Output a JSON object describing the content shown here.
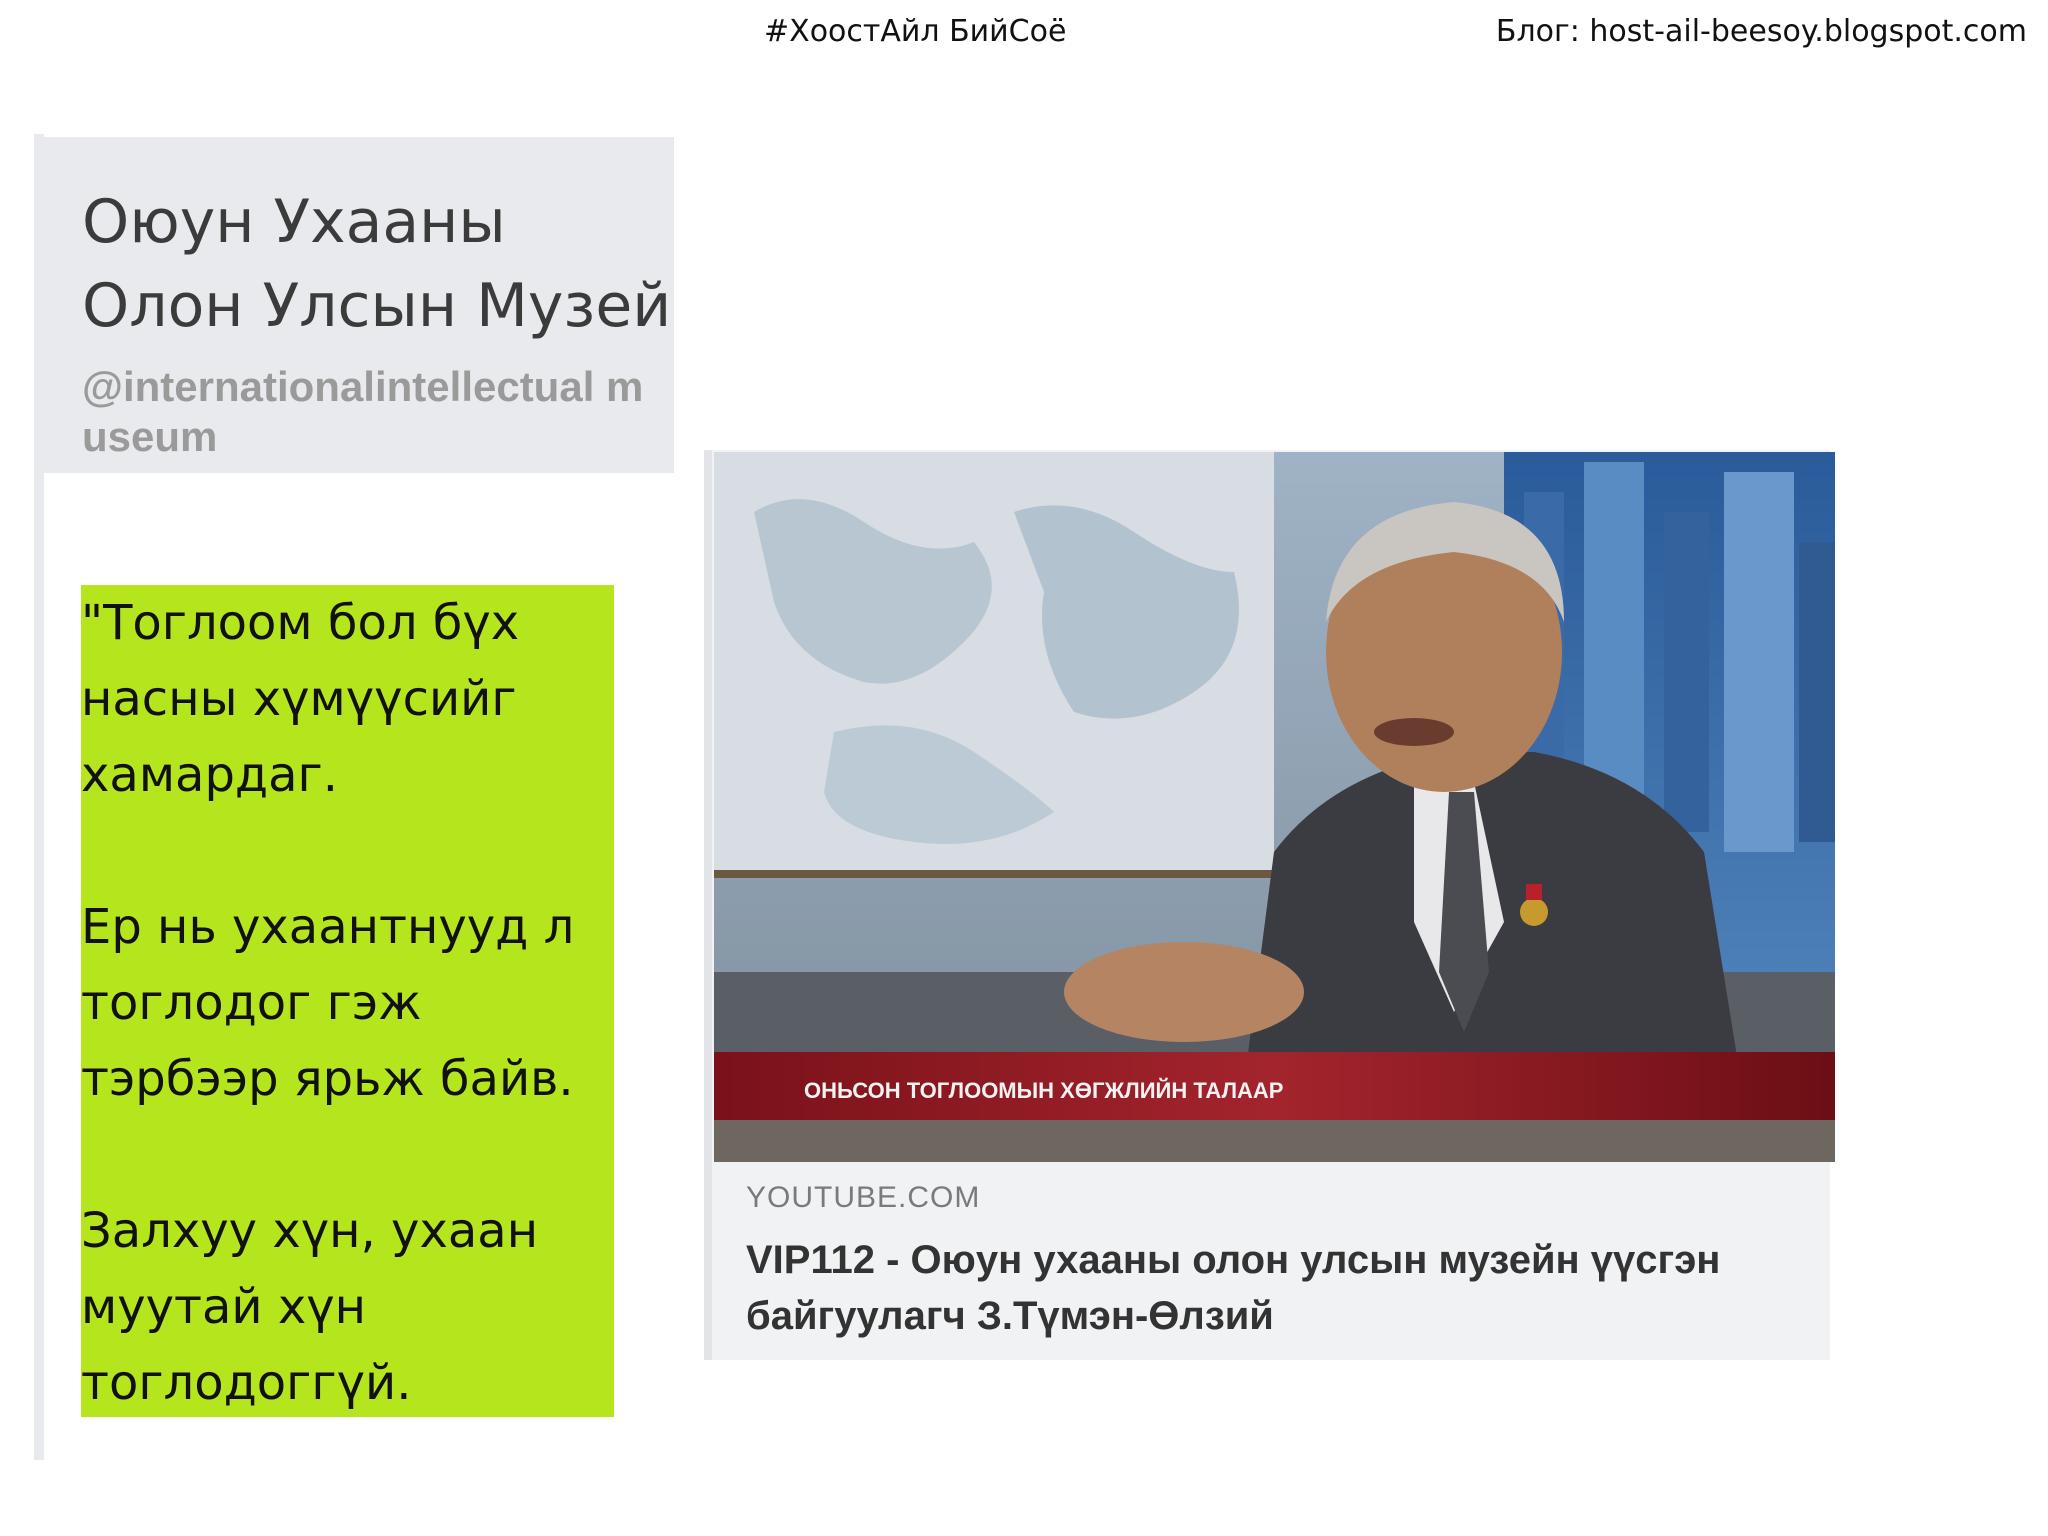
{
  "header": {
    "hashtag": "#ХоостАйл БийСоё",
    "blog": "Блог: host-ail-beesoy.blogspot.com"
  },
  "profile": {
    "name_line1": "Оюун Ухааны",
    "name_line2": "Олон Улсын Музей",
    "handle": "@internationalintellectual museum"
  },
  "quote": {
    "paragraphs": [
      "\"Тоглоом бол бүх насны хүмүүсийг хамардаг.",
      "Ер нь ухаантнууд л тоглодог гэж тэрбээр ярьж байв.",
      "Залхуу хүн, ухаан муутай хүн тоглодоггүй."
    ]
  },
  "video": {
    "lower_third": "ОНЬСОН ТОГЛООМЫН ХӨГЖЛИЙН ТАЛААР",
    "source": "YOUTUBE.COM",
    "title": "VIP112 - Оюун ухааны олон улсын музейн үүсгэн байгуулагч З.Түмэн-Өлзий"
  },
  "colors": {
    "quote_bg": "#b5e61d",
    "profile_bg": "#e9eaed",
    "card_bg": "#f1f2f4",
    "lower_third": "#8e1a22"
  }
}
